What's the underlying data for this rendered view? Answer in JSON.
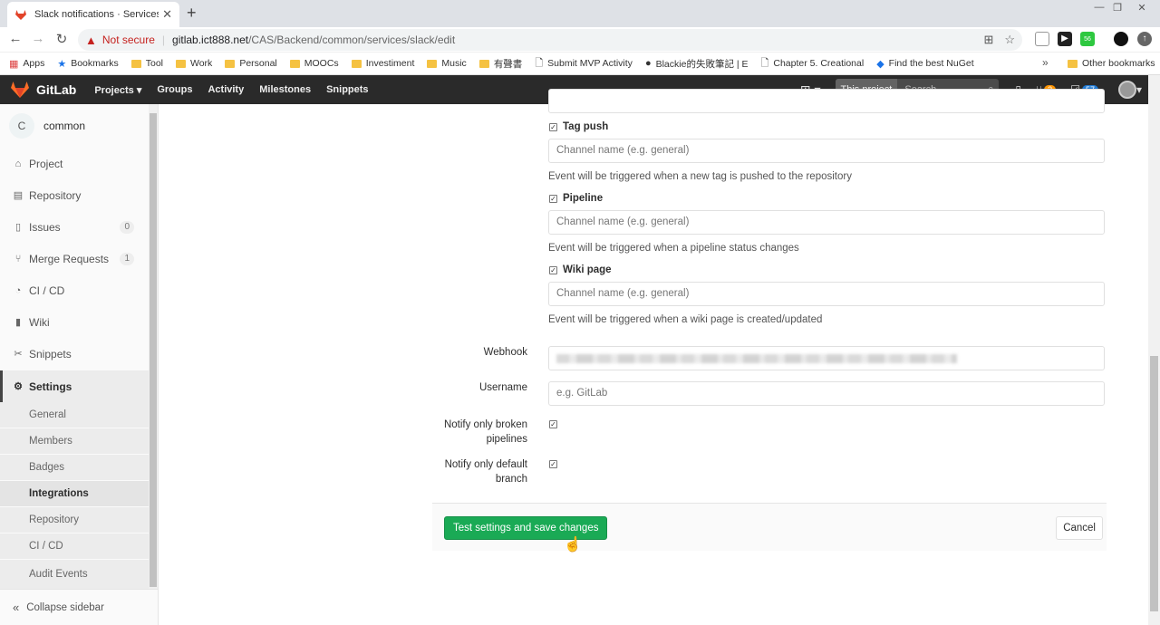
{
  "browser": {
    "tab_title": "Slack notifications · Services · Set",
    "url_warning": "Not secure",
    "url_host": "gitlab.ict888.net",
    "url_path": "/CAS/Backend/common/services/slack/edit",
    "ext_badge": "56",
    "bookmarks": [
      "Apps",
      "Bookmarks",
      "Tool",
      "Work",
      "Personal",
      "MOOCs",
      "Investiment",
      "Music",
      "有聲書",
      "Submit MVP Activity",
      "Blackie的失敗筆記 | E",
      "Chapter 5. Creational",
      "Find the best NuGet"
    ],
    "other_bookmarks": "Other bookmarks"
  },
  "gitlab_nav": {
    "logo": "GitLab",
    "links": [
      "Projects",
      "Groups",
      "Activity",
      "Milestones",
      "Snippets"
    ],
    "search_scope": "This project",
    "search_placeholder": "Search",
    "mr_count": "3",
    "todo_count": "57"
  },
  "sidebar": {
    "avatar_letter": "C",
    "project_name": "common",
    "items": [
      {
        "label": "Project",
        "icon": "house-icon"
      },
      {
        "label": "Repository",
        "icon": "book-icon"
      },
      {
        "label": "Issues",
        "icon": "issues-icon",
        "count": "0"
      },
      {
        "label": "Merge Requests",
        "icon": "merge-icon",
        "count": "1"
      },
      {
        "label": "CI / CD",
        "icon": "rocket-icon"
      },
      {
        "label": "Wiki",
        "icon": "wiki-icon"
      },
      {
        "label": "Snippets",
        "icon": "scissors-icon"
      },
      {
        "label": "Settings",
        "icon": "gear-icon"
      }
    ],
    "subitems": [
      "General",
      "Members",
      "Badges",
      "Integrations",
      "Repository",
      "CI / CD",
      "Audit Events"
    ],
    "collapse": "Collapse sidebar"
  },
  "form": {
    "channel_placeholder": "Channel name (e.g. general)",
    "tag_push_label": "Tag push",
    "tag_push_help": "Event will be triggered when a new tag is pushed to the repository",
    "pipeline_label": "Pipeline",
    "pipeline_help": "Event will be triggered when a pipeline status changes",
    "wiki_label": "Wiki page",
    "wiki_help": "Event will be triggered when a wiki page is created/updated",
    "webhook_label": "Webhook",
    "username_label": "Username",
    "username_placeholder": "e.g. GitLab",
    "notify_broken_line1": "Notify only broken",
    "notify_broken_line2": "pipelines",
    "notify_default_line1": "Notify only default",
    "notify_default_line2": "branch",
    "save_button": "Test settings and save changes",
    "cancel_button": "Cancel"
  }
}
